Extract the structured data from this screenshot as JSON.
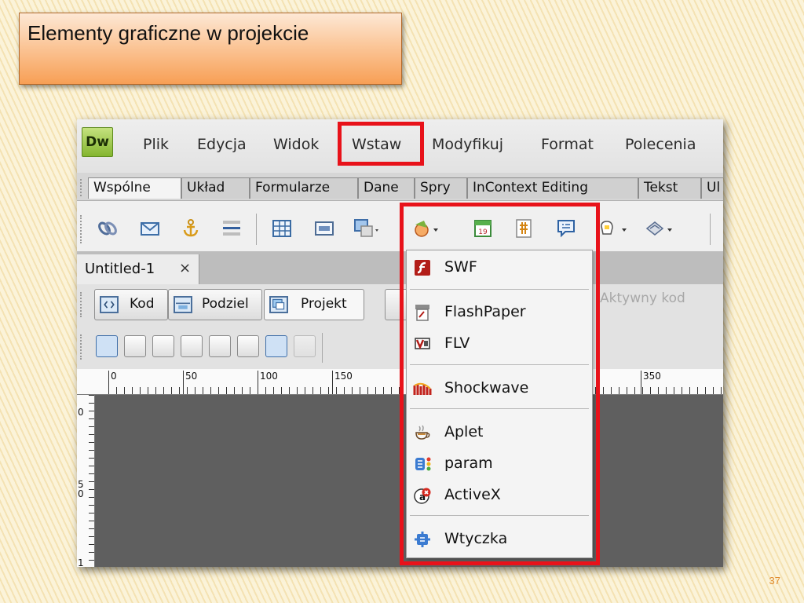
{
  "slide": {
    "title": "Elementy graficzne w projekcie",
    "page_number": "37"
  },
  "app": {
    "logo": "Dw",
    "menu": [
      "Plik",
      "Edycja",
      "Widok",
      "Wstaw",
      "Modyfikuj",
      "Format",
      "Polecenia"
    ],
    "highlighted_menu": "Wstaw",
    "insert_tabs": [
      "Wspólne",
      "Układ",
      "Formularze",
      "Dane",
      "Spry",
      "InContext Editing",
      "Tekst",
      "Ul"
    ],
    "active_insert_tab": "Wspólne",
    "toolbar_icons": [
      "hyperlink-icon",
      "email-link-icon",
      "named-anchor-icon",
      "horizontal-rule-icon",
      "table-icon",
      "insert-div-icon",
      "images-icon",
      "media-icon",
      "date-icon",
      "server-side-include-icon",
      "comment-icon",
      "head-icon",
      "script-icon"
    ],
    "document_tab": {
      "label": "Untitled-1",
      "close": "×"
    },
    "view_buttons": {
      "code": "Kod",
      "split": "Podziel",
      "design": "Projekt"
    },
    "live_code": "Aktywny kod",
    "ruler_labels": [
      "0",
      "50",
      "100",
      "150",
      "350"
    ],
    "vertical_ruler_labels": [
      "0",
      "5 0",
      "1"
    ]
  },
  "media_menu": {
    "items": [
      {
        "label": "SWF",
        "icon": "swf-icon"
      },
      {
        "label": "FlashPaper",
        "icon": "flashpaper-icon"
      },
      {
        "label": "FLV",
        "icon": "flv-icon"
      },
      {
        "label": "Shockwave",
        "icon": "shockwave-icon"
      },
      {
        "label": "Aplet",
        "icon": "applet-icon"
      },
      {
        "label": "param",
        "icon": "param-icon"
      },
      {
        "label": "ActiveX",
        "icon": "activex-icon"
      },
      {
        "label": "Wtyczka",
        "icon": "plugin-icon"
      }
    ]
  },
  "colors": {
    "highlight": "#e8121a",
    "title_box_top": "#fde8d5",
    "title_box_bottom": "#f79f55",
    "page_number": "#e08a2c"
  }
}
